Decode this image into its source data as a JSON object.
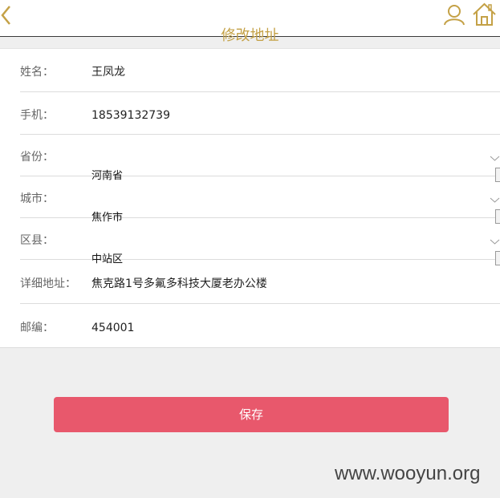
{
  "header": {
    "title": "修改地址",
    "back_icon": "chevron-left-icon",
    "user_icon": "user-icon",
    "home_icon": "home-icon",
    "accent_color": "#c4a146"
  },
  "form": {
    "name": {
      "label": "姓名：",
      "value": "王凤龙"
    },
    "phone": {
      "label": "手机：",
      "value": "18539132739"
    },
    "province": {
      "label": "省份：",
      "value": "河南省"
    },
    "city": {
      "label": "城市：",
      "value": "焦作市"
    },
    "district": {
      "label": "区县：",
      "value": "中站区"
    },
    "address": {
      "label": "详细地址：",
      "value": "焦克路1号多氟多科技大厦老办公楼"
    },
    "zipcode": {
      "label": "邮编：",
      "value": "454001"
    }
  },
  "save_button": {
    "label": "保存",
    "color": "#e8586c"
  },
  "watermark": "www.wooyun.org"
}
